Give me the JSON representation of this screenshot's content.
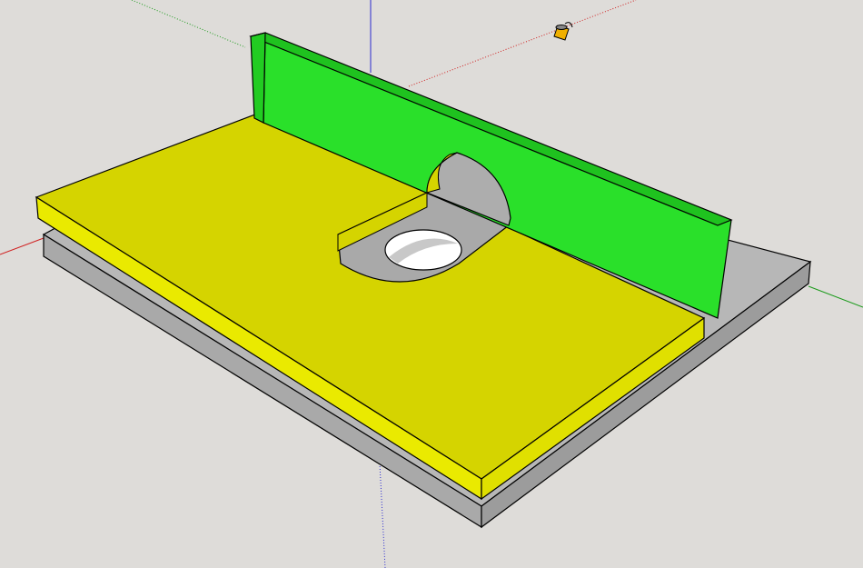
{
  "app": {
    "type": "3d-modeling-viewport"
  },
  "scene": {
    "background": "#dedcd9",
    "axes": {
      "red": "#d02020",
      "green": "#1a9a1a",
      "blue": "#2020d0"
    },
    "model": {
      "base_color": "#b5b5b5",
      "base_side_color": "#9a9a9a",
      "table_top_color": "#d6d400",
      "table_side_color": "#e6e600",
      "fence_color": "#2ae02a",
      "fence_side_color": "#22c022",
      "hole_color": "#ffffff",
      "cutout_color": "#a8a8a8",
      "edge_color": "#000000"
    },
    "cursor": {
      "icon": "paint-bucket-icon"
    }
  }
}
